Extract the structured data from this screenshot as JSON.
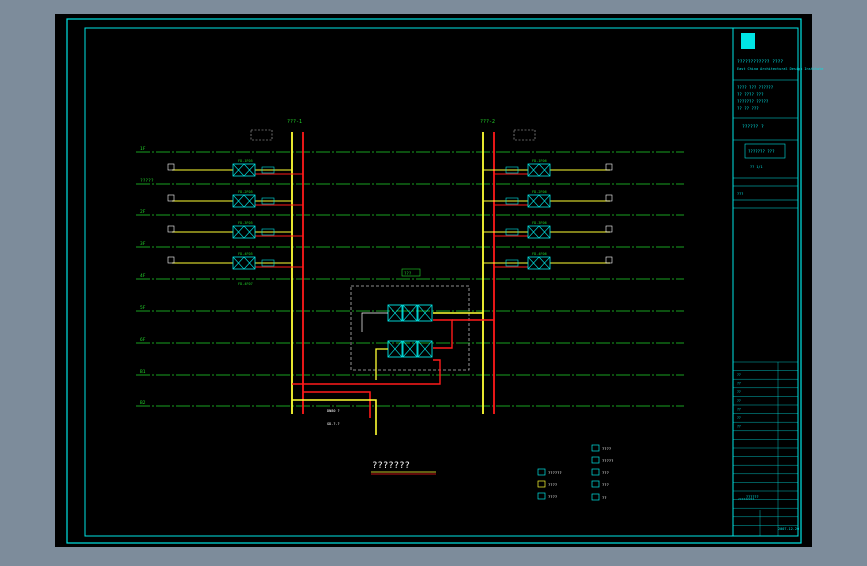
{
  "colors": {
    "background_outer": "#7d8c9b",
    "sheet": "#000000",
    "frame_cyan": "#00e5e5",
    "level_green": "#22d42a",
    "riser_red": "#ff1a1a",
    "riser_yellow": "#ffff33",
    "equipment_white": "#ffffff",
    "dashed_gray": "#bbbbbb"
  },
  "drawing": {
    "title": "???????",
    "risers_left_label": "???-1",
    "risers_right_label": "???-2",
    "center_box_tag": "??? ",
    "level_labels": [
      "1F",
      "?????",
      "2F",
      "3F",
      "4F",
      "5F",
      "6F",
      "B1",
      "B2"
    ],
    "equipment_tags_left": [
      "FD-1F05",
      "FD-2F05",
      "FD-3F05",
      "FD-4F05",
      "FD-4F07"
    ],
    "equipment_tags_right": [
      "FD-1F06",
      "FD-2F06",
      "FD-3F06",
      "FD-4F06"
    ],
    "pipe_note": "DN80 ?",
    "pipe_note_2": "GD-?-?"
  },
  "legend": {
    "items": [
      {
        "icon": "valve-box-icon",
        "label": "??????"
      },
      {
        "icon": "small-valve-icon",
        "label": "????"
      },
      {
        "icon": "pump-icon",
        "label": "????"
      },
      {
        "icon": "meter-icon",
        "label": "????"
      },
      {
        "icon": "flow-icon",
        "label": "?????"
      },
      {
        "icon": "tank-icon",
        "label": "???"
      },
      {
        "icon": "gauge-icon",
        "label": "???"
      },
      {
        "icon": "filter-icon",
        "label": "??"
      }
    ]
  },
  "title_block": {
    "company": "???????????? ????",
    "company_en": "East China Architectural Design Institute",
    "notes": [
      "???? ??? ??????",
      "?? ???? ???",
      "??????? ?????",
      "?? ?? ???"
    ],
    "drawing_name": "?????? ?",
    "drawing_title_box": "???????\n???",
    "sheet_no": "?? 1/1",
    "revision_rows": [
      "??",
      "??",
      "??",
      "??",
      "??",
      "??",
      "??"
    ],
    "scale_label": "???",
    "scale_value": "??????",
    "date": "2007.12.20",
    "stamp": "?????????"
  }
}
